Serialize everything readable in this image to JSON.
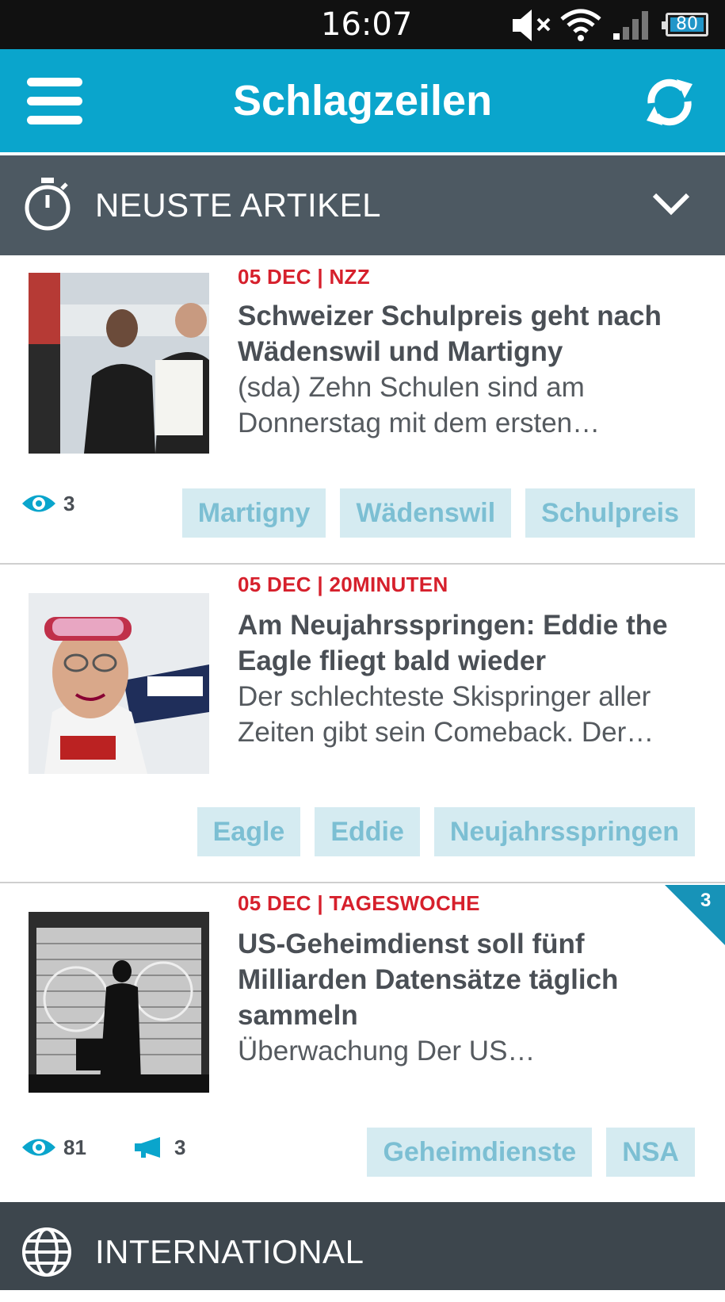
{
  "status_bar": {
    "time": "16:07",
    "battery": "80"
  },
  "app_bar": {
    "title": "Schlagzeilen"
  },
  "section_latest": {
    "label": "NEUSTE ARTIKEL"
  },
  "articles": [
    {
      "meta": "05 DEC | NZZ",
      "headline": "Schweizer Schulpreis geht nach Wädenswil und Martigny",
      "teaser": "(sda) Zehn Schulen sind am Donnerstag mit dem ersten…",
      "views": "3",
      "tags": [
        "Martigny",
        "Wädenswil",
        "Schulpreis"
      ]
    },
    {
      "meta": "05 DEC | 20MINUTEN",
      "headline": "Am Neujahrsspringen: Eddie the Eagle fliegt bald wieder",
      "teaser": "Der schlechteste Skispringer aller Zeiten gibt sein Comeback. Der…",
      "tags": [
        "Eagle",
        "Eddie",
        "Neujahrsspringen"
      ]
    },
    {
      "meta": "05 DEC | TAGESWOCHE",
      "headline": "US-Geheimdienst soll fünf Milliarden Datensätze täglich sammeln",
      "teaser": "Überwachung Der US…",
      "views": "81",
      "shares": "3",
      "corner_badge": "3",
      "tags": [
        "Geheimdienste",
        "NSA"
      ]
    }
  ],
  "section_international": {
    "label": "INTERNATIONAL"
  },
  "colors": {
    "appbar": "#0aa5cc",
    "section": "#4d5962",
    "meta_red": "#d6202c",
    "tag_bg": "#d5ebf1",
    "tag_text": "#7cbfd3"
  }
}
